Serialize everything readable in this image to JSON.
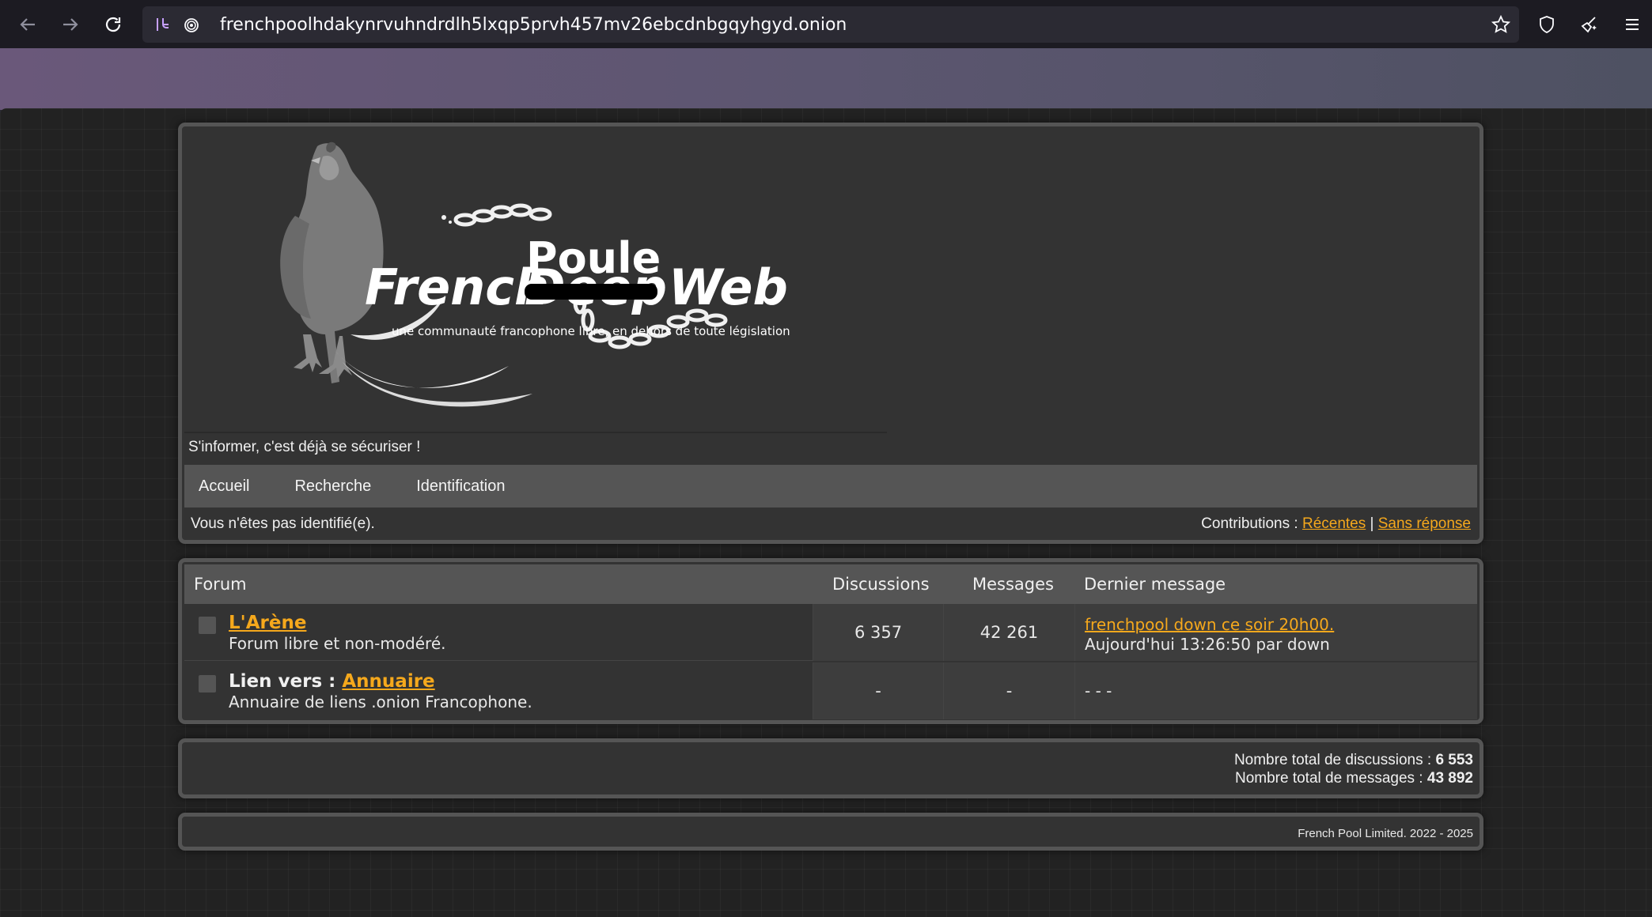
{
  "browser": {
    "url": "frenchpoolhdakynrvuhndrdlh5lxqp5prvh457mv26ebcdnbgqyhgyd.onion",
    "back_icon": "arrow-left-icon",
    "forward_icon": "arrow-right-icon",
    "reload_icon": "reload-icon"
  },
  "banner": {
    "logo_french": "French",
    "logo_deep": "Deep",
    "logo_poule": "Poule",
    "logo_web": "Web",
    "logo_subtitle": "une communauté francophone libre, en dehors de toute législation",
    "tagline": "S'informer, c'est déjà se sécuriser !"
  },
  "menu": {
    "items": [
      "Accueil",
      "Recherche",
      "Identification"
    ]
  },
  "status": {
    "login_status": "Vous n'êtes pas identifié(e).",
    "contributions_label": "Contributions :",
    "recent_label": "Récentes",
    "separator": "|",
    "unanswered_label": "Sans réponse"
  },
  "forum_table": {
    "headers": {
      "forum": "Forum",
      "discussions": "Discussions",
      "messages": "Messages",
      "last_message": "Dernier message"
    },
    "rows": [
      {
        "title_prefix": "",
        "title_link": "L'Arène",
        "description": "Forum libre et non-modéré.",
        "discussions": "6 357",
        "messages": "42 261",
        "last_link": "frenchpool down ce soir 20h00.",
        "last_meta": "Aujourd'hui 13:26:50 par down"
      },
      {
        "title_prefix": "Lien vers :",
        "title_link": "Annuaire",
        "description": "Annuaire de liens .onion Francophone.",
        "discussions": "-",
        "messages": "-",
        "last_link": "",
        "last_meta": "- - -"
      }
    ]
  },
  "stats": {
    "total_discussions_label": "Nombre total de discussions :",
    "total_discussions": "6 553",
    "total_messages_label": "Nombre total de messages :",
    "total_messages": "43 892"
  },
  "footer": {
    "text": "French Pool Limited. 2022 - 2025"
  },
  "colors": {
    "link": "#f5a81c",
    "panel": "#333333",
    "header_bar": "#555555",
    "page_bg": "#222222"
  }
}
